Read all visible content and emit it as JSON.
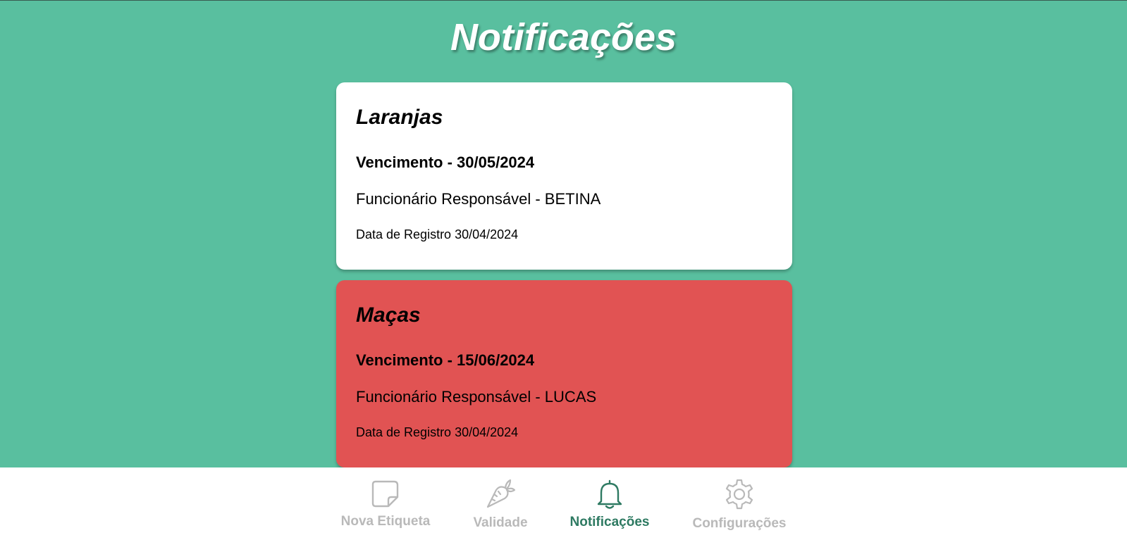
{
  "page": {
    "title": "Notificações"
  },
  "colors": {
    "background": "#59bf9f",
    "card_normal": "#ffffff",
    "card_alert": "#e15353",
    "nav_active": "#2e7a62",
    "nav_inactive": "#b9b9b9"
  },
  "notifications": [
    {
      "product": "Laranjas",
      "expiry": "Vencimento - 30/05/2024",
      "employee": "Funcionário Responsável - BETINA",
      "registered": "Data de Registro 30/04/2024",
      "status": "normal"
    },
    {
      "product": "Maças",
      "expiry": "Vencimento - 15/06/2024",
      "employee": "Funcionário Responsável - LUCAS",
      "registered": "Data de Registro 30/04/2024",
      "status": "alert"
    }
  ],
  "nav": {
    "items": [
      {
        "label": "Nova Etiqueta",
        "icon": "sticky-note-icon",
        "active": false
      },
      {
        "label": "Validade",
        "icon": "carrot-icon",
        "active": false
      },
      {
        "label": "Notificações",
        "icon": "bell-icon",
        "active": true
      },
      {
        "label": "Configurações",
        "icon": "gear-icon",
        "active": false
      }
    ]
  }
}
